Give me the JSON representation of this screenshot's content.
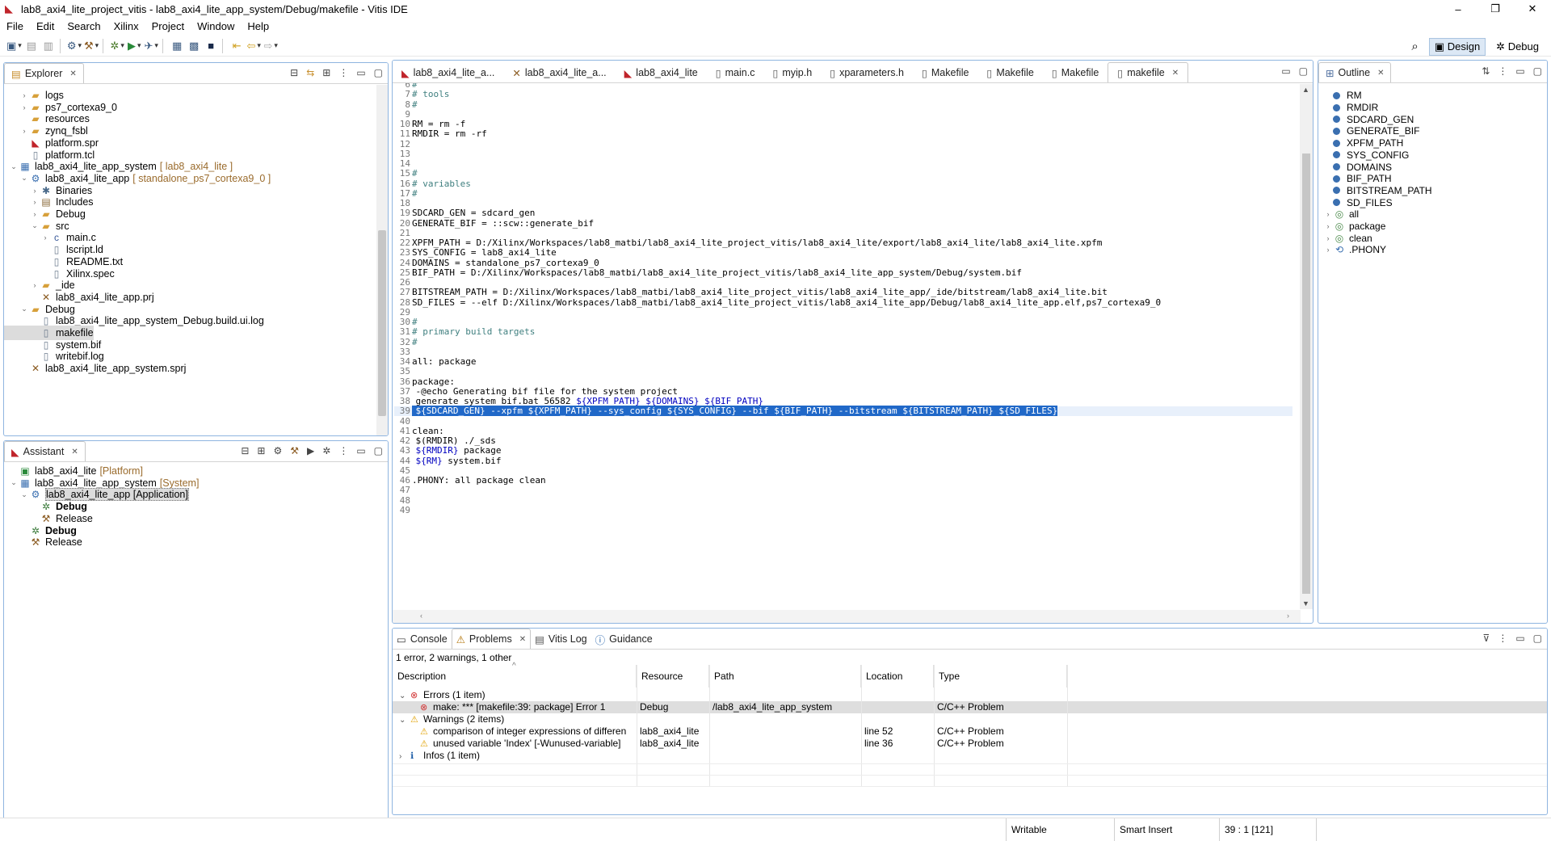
{
  "window": {
    "title": "lab8_axi4_lite_project_vitis - lab8_axi4_lite_app_system/Debug/makefile - Vitis IDE",
    "controls": [
      "–",
      "❐",
      "✕"
    ]
  },
  "menu": [
    "File",
    "Edit",
    "Search",
    "Xilinx",
    "Project",
    "Window",
    "Help"
  ],
  "perspectives": {
    "design": "Design",
    "debug": "Debug"
  },
  "explorer": {
    "tab": "Explorer",
    "items": [
      {
        "label": "logs",
        "deco": "",
        "indent": 1,
        "twisty": "›",
        "icon": "folder"
      },
      {
        "label": "ps7_cortexa9_0",
        "deco": "",
        "indent": 1,
        "twisty": "›",
        "icon": "folder"
      },
      {
        "label": "resources",
        "deco": "",
        "indent": 1,
        "twisty": "",
        "icon": "folder"
      },
      {
        "label": "zynq_fsbl",
        "deco": "",
        "indent": 1,
        "twisty": "›",
        "icon": "folder"
      },
      {
        "label": "platform.spr",
        "deco": "",
        "indent": 1,
        "twisty": "",
        "icon": "vitis"
      },
      {
        "label": "platform.tcl",
        "deco": "",
        "indent": 1,
        "twisty": "",
        "icon": "file"
      },
      {
        "label": "lab8_axi4_lite_app_system",
        "deco": "[ lab8_axi4_lite ]",
        "indent": 0,
        "twisty": "⌄",
        "icon": "system"
      },
      {
        "label": "lab8_axi4_lite_app",
        "deco": "[ standalone_ps7_cortexa9_0 ]",
        "indent": 1,
        "twisty": "⌄",
        "icon": "app"
      },
      {
        "label": "Binaries",
        "deco": "",
        "indent": 2,
        "twisty": "›",
        "icon": "bin"
      },
      {
        "label": "Includes",
        "deco": "",
        "indent": 2,
        "twisty": "›",
        "icon": "inc"
      },
      {
        "label": "Debug",
        "deco": "",
        "indent": 2,
        "twisty": "›",
        "icon": "folder"
      },
      {
        "label": "src",
        "deco": "",
        "indent": 2,
        "twisty": "⌄",
        "icon": "folder"
      },
      {
        "label": "main.c",
        "deco": "",
        "indent": 3,
        "twisty": "›",
        "icon": "c"
      },
      {
        "label": "lscript.ld",
        "deco": "",
        "indent": 3,
        "twisty": "",
        "icon": "file"
      },
      {
        "label": "README.txt",
        "deco": "",
        "indent": 3,
        "twisty": "",
        "icon": "file"
      },
      {
        "label": "Xilinx.spec",
        "deco": "",
        "indent": 3,
        "twisty": "",
        "icon": "file"
      },
      {
        "label": "_ide",
        "deco": "",
        "indent": 2,
        "twisty": "›",
        "icon": "folder"
      },
      {
        "label": "lab8_axi4_lite_app.prj",
        "deco": "",
        "indent": 2,
        "twisty": "",
        "icon": "prj"
      },
      {
        "label": "Debug",
        "deco": "",
        "indent": 1,
        "twisty": "⌄",
        "icon": "folder"
      },
      {
        "label": "lab8_axi4_lite_app_system_Debug.build.ui.log",
        "deco": "",
        "indent": 2,
        "twisty": "",
        "icon": "file"
      },
      {
        "label": "makefile",
        "deco": "",
        "indent": 2,
        "twisty": "",
        "icon": "file",
        "selected": true
      },
      {
        "label": "system.bif",
        "deco": "",
        "indent": 2,
        "twisty": "",
        "icon": "file"
      },
      {
        "label": "writebif.log",
        "deco": "",
        "indent": 2,
        "twisty": "",
        "icon": "file"
      },
      {
        "label": "lab8_axi4_lite_app_system.sprj",
        "deco": "",
        "indent": 1,
        "twisty": "",
        "icon": "prj"
      }
    ]
  },
  "assistant": {
    "tab": "Assistant",
    "items": [
      {
        "label": "lab8_axi4_lite",
        "deco": "[Platform]",
        "indent": 0,
        "twisty": "",
        "bold": false
      },
      {
        "label": "lab8_axi4_lite_app_system",
        "deco": "[System]",
        "indent": 0,
        "twisty": "⌄",
        "bold": false
      },
      {
        "label": "lab8_axi4_lite_app [Application]",
        "deco": "",
        "indent": 1,
        "twisty": "⌄",
        "bold": false,
        "selected": true
      },
      {
        "label": "Debug",
        "deco": "",
        "indent": 2,
        "twisty": "",
        "bold": true
      },
      {
        "label": "Release",
        "deco": "",
        "indent": 2,
        "twisty": "",
        "bold": false
      },
      {
        "label": "Debug",
        "deco": "",
        "indent": 1,
        "twisty": "",
        "bold": true
      },
      {
        "label": "Release",
        "deco": "",
        "indent": 1,
        "twisty": "",
        "bold": false
      }
    ]
  },
  "editor": {
    "tabs": [
      "lab8_axi4_lite_a...",
      "lab8_axi4_lite_a...",
      "lab8_axi4_lite",
      "main.c",
      "myip.h",
      "xparameters.h",
      "Makefile",
      "Makefile",
      "Makefile",
      "makefile"
    ],
    "lines": [
      {
        "n": "6",
        "t": "#"
      },
      {
        "n": "7",
        "t": "# tools"
      },
      {
        "n": "8",
        "t": "#"
      },
      {
        "n": "9",
        "t": ""
      },
      {
        "n": "10",
        "t": "RM = rm -f"
      },
      {
        "n": "11",
        "t": "RMDIR = rm -rf"
      },
      {
        "n": "12",
        "t": ""
      },
      {
        "n": "13",
        "t": ""
      },
      {
        "n": "14",
        "t": ""
      },
      {
        "n": "15",
        "t": "#"
      },
      {
        "n": "16",
        "t": "# variables"
      },
      {
        "n": "17",
        "t": "#"
      },
      {
        "n": "18",
        "t": ""
      },
      {
        "n": "19",
        "t": "SDCARD_GEN = sdcard_gen"
      },
      {
        "n": "20",
        "t": "GENERATE_BIF = ::scw::generate_bif"
      },
      {
        "n": "21",
        "t": ""
      },
      {
        "n": "22",
        "t": "XPFM_PATH = D:/Xilinx/Workspaces/lab8_matbi/lab8_axi4_lite_project_vitis/lab8_axi4_lite/export/lab8_axi4_lite/lab8_axi4_lite.xpfm"
      },
      {
        "n": "23",
        "t": "SYS_CONFIG = lab8_axi4_lite"
      },
      {
        "n": "24",
        "t": "DOMAINS = standalone_ps7_cortexa9_0"
      },
      {
        "n": "25",
        "t": "BIF_PATH = D:/Xilinx/Workspaces/lab8_matbi/lab8_axi4_lite_project_vitis/lab8_axi4_lite_app_system/Debug/system.bif"
      },
      {
        "n": "26",
        "t": ""
      },
      {
        "n": "27",
        "t": "BITSTREAM_PATH = D:/Xilinx/Workspaces/lab8_matbi/lab8_axi4_lite_project_vitis/lab8_axi4_lite_app/_ide/bitstream/lab8_axi4_lite.bit"
      },
      {
        "n": "28",
        "t": "SD_FILES = --elf D:/Xilinx/Workspaces/lab8_matbi/lab8_axi4_lite_project_vitis/lab8_axi4_lite_app/Debug/lab8_axi4_lite_app.elf,ps7_cortexa9_0"
      },
      {
        "n": "29",
        "t": ""
      },
      {
        "n": "30",
        "t": "#"
      },
      {
        "n": "31",
        "t": "# primary build targets"
      },
      {
        "n": "32",
        "t": "#"
      },
      {
        "n": "33",
        "t": ""
      },
      {
        "n": "34",
        "t": "all: package"
      },
      {
        "n": "35",
        "t": ""
      },
      {
        "n": "36",
        "t": "package:"
      },
      {
        "n": "37",
        "t": "\t-@echo Generating bif file for the system project"
      },
      {
        "n": "38",
        "t": "\tgenerate_system_bif.bat 56582 ${XPFM_PATH} ${DOMAINS} ${BIF_PATH}"
      },
      {
        "n": "39",
        "t": "\t${SDCARD_GEN} --xpfm ${XPFM_PATH} --sys_config ${SYS_CONFIG} --bif ${BIF_PATH} --bitstream ${BITSTREAM_PATH} ${SD_FILES}"
      },
      {
        "n": "40",
        "t": ""
      },
      {
        "n": "41",
        "t": "clean:"
      },
      {
        "n": "42",
        "t": "\t$(RMDIR) ./_sds"
      },
      {
        "n": "43",
        "t": "\t${RMDIR} package"
      },
      {
        "n": "44",
        "t": "\t${RM} system.bif"
      },
      {
        "n": "45",
        "t": ""
      },
      {
        "n": "46",
        "t": ".PHONY: all package clean"
      },
      {
        "n": "47",
        "t": ""
      },
      {
        "n": "48",
        "t": ""
      },
      {
        "n": "49",
        "t": ""
      }
    ],
    "highlighted_line": "39"
  },
  "outline": {
    "tab": "Outline",
    "items": [
      {
        "label": "RM",
        "kind": "var"
      },
      {
        "label": "RMDIR",
        "kind": "var"
      },
      {
        "label": "SDCARD_GEN",
        "kind": "var"
      },
      {
        "label": "GENERATE_BIF",
        "kind": "var"
      },
      {
        "label": "XPFM_PATH",
        "kind": "var"
      },
      {
        "label": "SYS_CONFIG",
        "kind": "var"
      },
      {
        "label": "DOMAINS",
        "kind": "var"
      },
      {
        "label": "BIF_PATH",
        "kind": "var"
      },
      {
        "label": "BITSTREAM_PATH",
        "kind": "var"
      },
      {
        "label": "SD_FILES",
        "kind": "var"
      },
      {
        "label": "all",
        "kind": "target"
      },
      {
        "label": "package",
        "kind": "target"
      },
      {
        "label": "clean",
        "kind": "target"
      },
      {
        "label": ".PHONY",
        "kind": "phony"
      }
    ]
  },
  "bottom": {
    "tabs": [
      "Console",
      "Problems",
      "Vitis Log",
      "Guidance"
    ],
    "summary": "1 error, 2 warnings, 1 other",
    "columns": [
      "Description",
      "Resource",
      "Path",
      "Location",
      "Type"
    ],
    "rows": [
      {
        "kind": "group",
        "icon": "error",
        "twisty": "⌄",
        "desc": "Errors (1 item)",
        "resource": "",
        "path": "",
        "location": "",
        "type": ""
      },
      {
        "kind": "item",
        "icon": "error",
        "twisty": "",
        "desc": "make: *** [makefile:39: package] Error 1",
        "resource": "Debug",
        "path": "/lab8_axi4_lite_app_system",
        "location": "",
        "type": "C/C++ Problem",
        "selected": true
      },
      {
        "kind": "group",
        "icon": "warning",
        "twisty": "⌄",
        "desc": "Warnings (2 items)",
        "resource": "",
        "path": "",
        "location": "",
        "type": ""
      },
      {
        "kind": "item",
        "icon": "warning",
        "twisty": "",
        "desc": "comparison of integer expressions of differen",
        "resource": "lab8_axi4_lite",
        "path": "",
        "location": "line 52",
        "type": "C/C++ Problem"
      },
      {
        "kind": "item",
        "icon": "warning",
        "twisty": "",
        "desc": "unused variable 'Index' [-Wunused-variable]",
        "resource": "lab8_axi4_lite",
        "path": "",
        "location": "line 36",
        "type": "C/C++ Problem"
      },
      {
        "kind": "group",
        "icon": "info",
        "twisty": "›",
        "desc": "Infos (1 item)",
        "resource": "",
        "path": "",
        "location": "",
        "type": ""
      }
    ]
  },
  "status": {
    "writable": "Writable",
    "insert": "Smart Insert",
    "position": "39 : 1 [121]"
  }
}
